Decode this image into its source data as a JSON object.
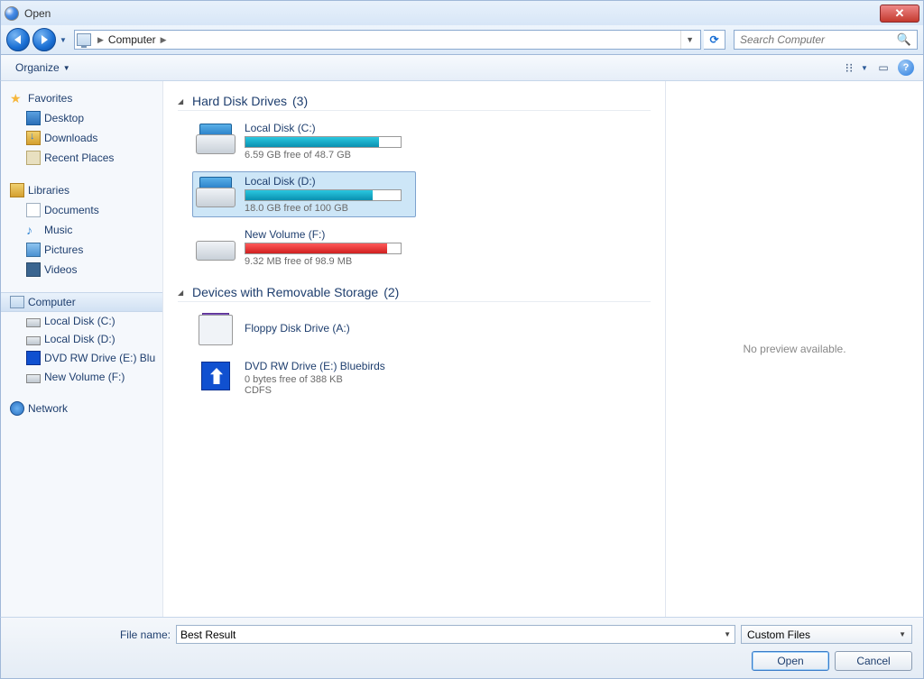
{
  "window": {
    "title": "Open"
  },
  "navbar": {
    "location": "Computer",
    "refresh_glyph": "⟳",
    "search_placeholder": "Search Computer"
  },
  "toolbar": {
    "organize": "Organize",
    "view_glyph": "⁝⁝",
    "preview_glyph": "▭",
    "help_glyph": "?"
  },
  "sidebar": {
    "favorites_label": "Favorites",
    "favorites": [
      {
        "label": "Desktop"
      },
      {
        "label": "Downloads"
      },
      {
        "label": "Recent Places"
      }
    ],
    "libraries_label": "Libraries",
    "libraries": [
      {
        "label": "Documents"
      },
      {
        "label": "Music"
      },
      {
        "label": "Pictures"
      },
      {
        "label": "Videos"
      }
    ],
    "computer_label": "Computer",
    "computer": [
      {
        "label": "Local Disk (C:)"
      },
      {
        "label": "Local Disk (D:)"
      },
      {
        "label": "DVD RW Drive (E:) Blu"
      },
      {
        "label": "New Volume (F:)"
      }
    ],
    "network_label": "Network"
  },
  "sections": {
    "hdd": {
      "title": "Hard Disk Drives",
      "count": "(3)"
    },
    "removable": {
      "title": "Devices with Removable Storage",
      "count": "(2)"
    }
  },
  "drives": {
    "c": {
      "name": "Local Disk (C:)",
      "free": "6.59 GB free of 48.7 GB",
      "pct": 86,
      "color": "blue"
    },
    "d": {
      "name": "Local Disk (D:)",
      "free": "18.0 GB free of 100 GB",
      "pct": 82,
      "color": "blue"
    },
    "f": {
      "name": "New Volume (F:)",
      "free": "9.32 MB free of 98.9 MB",
      "pct": 91,
      "color": "red"
    },
    "a": {
      "name": "Floppy Disk Drive (A:)"
    },
    "e": {
      "name": "DVD RW Drive (E:) Bluebirds",
      "free": "0 bytes free of 388 KB",
      "fs": "CDFS"
    }
  },
  "preview": {
    "none": "No preview available."
  },
  "bottom": {
    "filename_label": "File name:",
    "filename_value": "Best Result",
    "filetype": "Custom Files",
    "open": "Open",
    "cancel": "Cancel"
  }
}
